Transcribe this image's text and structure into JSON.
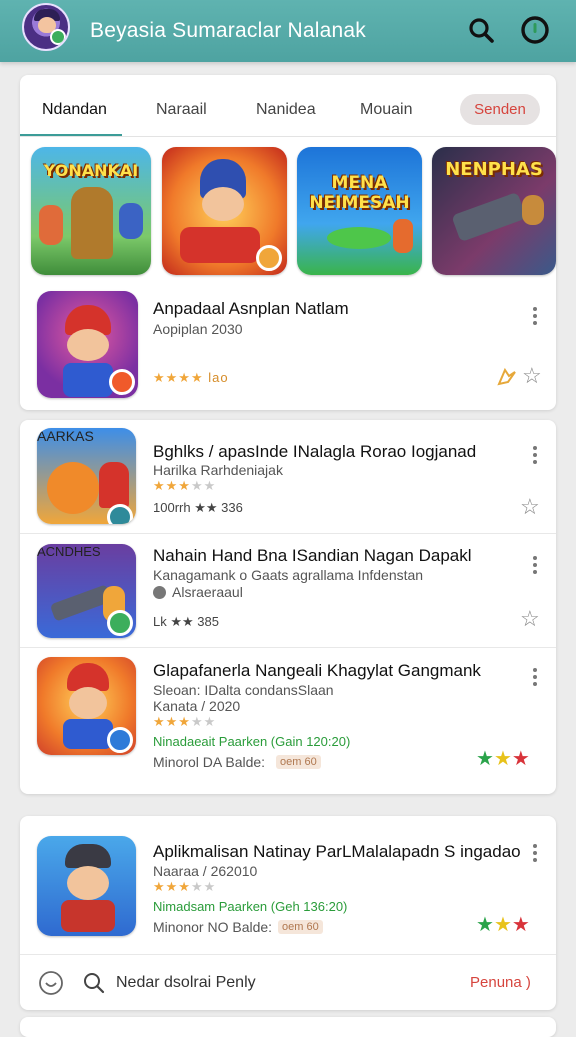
{
  "header": {
    "title": "Beyasia Sumaraclar Nalanak",
    "icons": [
      "avatar",
      "search-icon",
      "menu-icon"
    ]
  },
  "tabs": [
    {
      "label": "Ndandan"
    },
    {
      "label": "Naraail"
    },
    {
      "label": "Nanidea"
    },
    {
      "label": "Mouain"
    }
  ],
  "tab_pill": "Senden",
  "featured": [
    {
      "caption": "YONANKAI"
    },
    {
      "caption": ""
    },
    {
      "caption": "MENA NEIMESAH"
    },
    {
      "caption": "NENPHAS"
    }
  ],
  "featured_row": {
    "title": "Anpadaal Asnplan Natlam",
    "subtitle": "Aopiplan 2030",
    "rating_text": "lao",
    "stars_on": 4
  },
  "list": [
    {
      "caption": "AARKAS",
      "title": "Bghlks / apasInde INalagla Rorao Iogjanad",
      "line1": "Harilka Rarhdeniajak",
      "line2": "100rrh ★★ 336",
      "stars_on": 3
    },
    {
      "caption": "ACNDHES",
      "title": "Nahain Hand Bna ISandian Nagan Dapakl",
      "line1": "Kanagamank o Gaats agrallama Infdenstan",
      "line2": "Alsraeraaul",
      "line3": "Lk ★★ 385"
    },
    {
      "caption": "",
      "title": "Glapafanerla Nangeali Khagylat Gangmank",
      "line1": "Sleoan: IDalta condansSlaan",
      "line2": "Kanata / 2020",
      "green": "Ninadaeait Paarken (Gain 120:20)",
      "meta_label": "Minorol DA Balde:",
      "meta_tag": "oem 60",
      "stars_on": 3
    }
  ],
  "bottom_item": {
    "title": "Aplikmalisan Natinay ParLMalalapadn S ingadao",
    "line1": "Naaraa / 262010",
    "green": "Nimadsam Paarken (Geh 136:20)",
    "meta_label": "Minonor NO Balde:",
    "meta_tag": "oem 60",
    "stars_on": 3
  },
  "footer_bar": {
    "search_text": "Nedar dsolrai Penly",
    "action": "Penuna )"
  },
  "colors": {
    "header": "#56aba8",
    "accent": "#3c9c98",
    "pill_text": "#d6453e",
    "star": "#f0a63a",
    "green_text": "#2a9c3a"
  }
}
